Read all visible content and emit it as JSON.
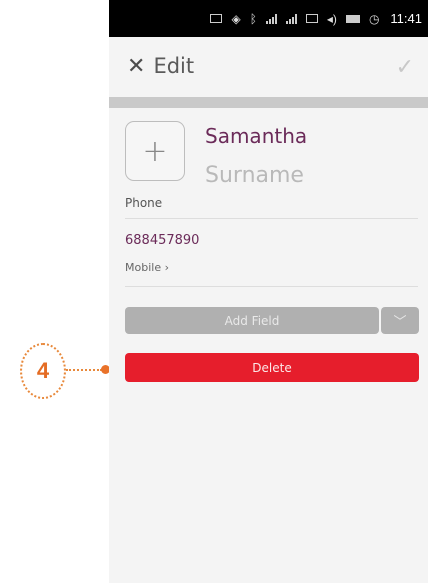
{
  "callout": {
    "number": "4"
  },
  "status_bar": {
    "time": "11:41"
  },
  "header": {
    "close_glyph": "✕",
    "title": "Edit",
    "confirm_glyph": "✓"
  },
  "contact": {
    "first_name": "Samantha",
    "surname_placeholder": "Surname",
    "avatar_glyph": "+"
  },
  "phone_field": {
    "label": "Phone",
    "number": "688457890",
    "type_label": "Mobile ›"
  },
  "buttons": {
    "add_field": "Add Field",
    "dropdown_glyph": "﹀",
    "delete": "Delete"
  },
  "colors": {
    "accent_text": "#6b2b59",
    "delete": "#e61e2c",
    "callout": "#e8893b"
  },
  "icons": [
    "mail-icon",
    "location-icon",
    "bluetooth-icon",
    "signal-icon",
    "signal-icon",
    "3g-icon",
    "volume-icon",
    "battery-icon",
    "clock-icon"
  ]
}
